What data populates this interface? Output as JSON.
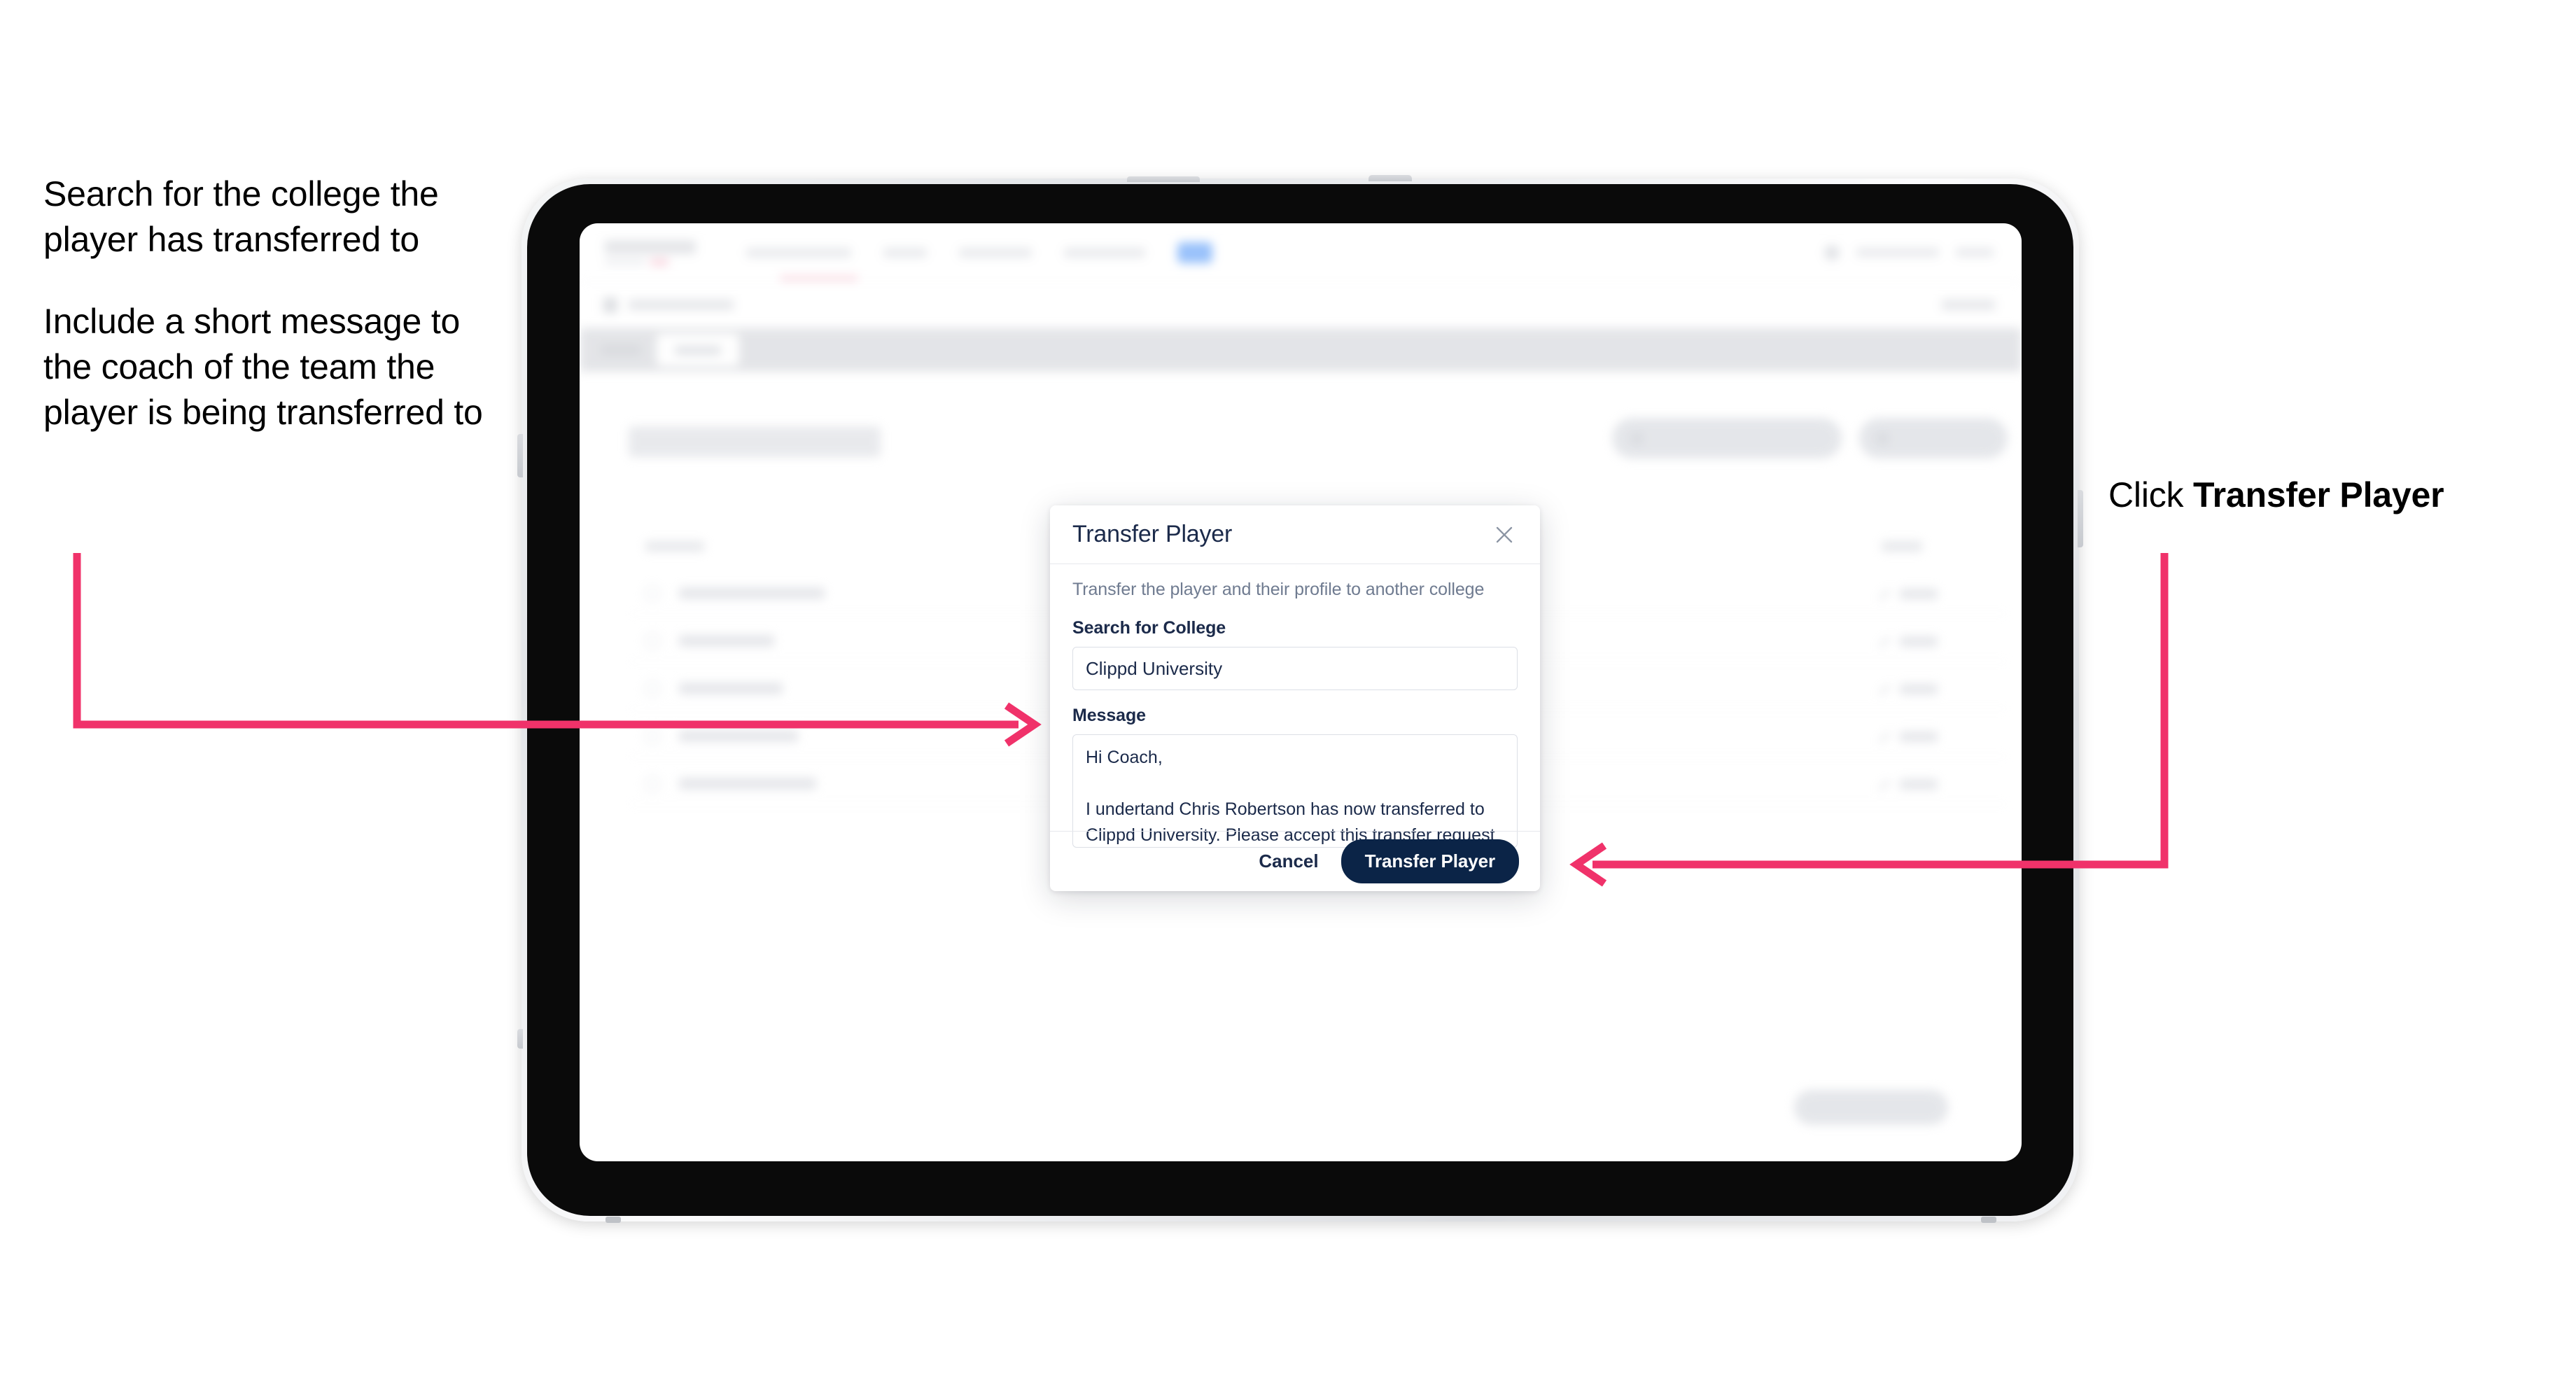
{
  "annotations": {
    "left": [
      "Search for the college the player has transferred to",
      "Include a short message to the coach of the team the player is being transferred to"
    ],
    "right_prefix": "Click ",
    "right_bold": "Transfer Player",
    "arrow_color": "#F0326A"
  },
  "device": {
    "type": "tablet",
    "frame_color": "#e7e9ec",
    "bezel_color": "#0a0a0a"
  },
  "background_app": {
    "page_title": "Update Roster",
    "tab_active": "Roster",
    "header_buttons": [
      "Request Player Transfer",
      "Add Player"
    ],
    "table_headers": [
      "Name",
      "Edit"
    ],
    "players": [
      "Chris Robertson",
      "Ian Winter",
      "John Taylor",
      "Lewis Warden",
      "Nathan Johnson"
    ],
    "row_action_label": "Edit",
    "footer_button": "Save And Continue"
  },
  "modal": {
    "title": "Transfer Player",
    "close_icon": "close-icon",
    "description": "Transfer the player and their profile to another college",
    "college_label": "Search for College",
    "college_value": "Clippd University",
    "college_placeholder": "Search for College",
    "message_label": "Message",
    "message_value": "Hi Coach,\n\nI undertand Chris Robertson has now transferred to Clippd University. Please accept this transfer request when you can.",
    "message_placeholder": "Message",
    "cancel_label": "Cancel",
    "submit_label": "Transfer Player",
    "primary_color": "#0B2447"
  }
}
